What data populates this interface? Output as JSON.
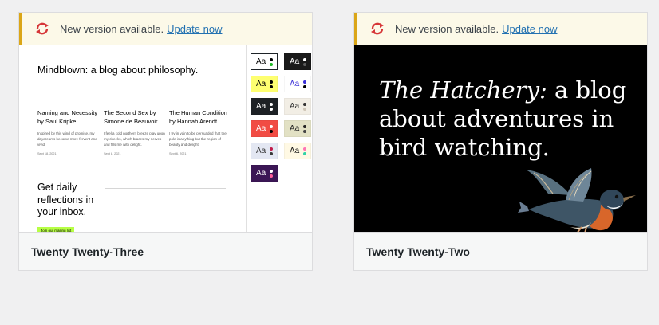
{
  "notice": {
    "text": "New version available.",
    "link": "Update now"
  },
  "themes": [
    {
      "name": "Twenty Twenty-Three",
      "preview": {
        "site_title": "Mindblown: a blog about philosophy.",
        "posts": [
          {
            "title": "Naming and Necessity by Saul Kripke",
            "excerpt": "Inspired by this wind of promise, my daydreams become more fervent and vivid.",
            "date": "Sept 18, 2021"
          },
          {
            "title": "The Second Sex by Simone de Beauvoir",
            "excerpt": "I feel a cold northern breeze play upon my cheeks, which braces my nerves and fills me with delight.",
            "date": "Sept 8, 2021"
          },
          {
            "title": "The Human Condition by Hannah Arendt",
            "excerpt": "I try in vain to be persuaded that the pole is anything but the region of beauty and delight.",
            "date": "Sept 6, 2021"
          }
        ],
        "cta": "Get daily reflections in your inbox.",
        "cta_button": "Join our mailing list",
        "swatch_label": "Aa",
        "swatches": [
          {
            "bg": "#ffffff",
            "fg": "#000000",
            "dots": [
              "#000000",
              "#1db924"
            ],
            "selected": true
          },
          {
            "bg": "#1a1a1a",
            "fg": "#ffffff",
            "dots": [
              "#ffffff",
              "#5b5b5b"
            ]
          },
          {
            "bg": "#feff70",
            "fg": "#000000",
            "dots": [
              "#000000",
              "#000000"
            ]
          },
          {
            "bg": "#ffffff",
            "fg": "#3a2fd8",
            "dots": [
              "#3a2fd8",
              "#000000"
            ]
          },
          {
            "bg": "#1d2125",
            "fg": "#ffffff",
            "dots": [
              "#ffffff",
              "#ffffff"
            ]
          },
          {
            "bg": "#f2eee5",
            "fg": "#333333",
            "dots": [
              "#333333",
              "#cfc6b8"
            ]
          },
          {
            "bg": "#f14c44",
            "fg": "#ffffff",
            "dots": [
              "#ffffff",
              "#000000"
            ]
          },
          {
            "bg": "#e2e1c4",
            "fg": "#222222",
            "dots": [
              "#222222",
              "#444444"
            ]
          },
          {
            "bg": "#e3e7f2",
            "fg": "#333333",
            "dots": [
              "#c11c4a",
              "#3a3a3a"
            ]
          },
          {
            "bg": "#fff9e4",
            "fg": "#111111",
            "dots": [
              "#ff74b4",
              "#31d3a6"
            ]
          },
          {
            "bg": "#3b1655",
            "fg": "#ffffff",
            "dots": [
              "#ffffff",
              "#ff5d9a"
            ]
          }
        ]
      }
    },
    {
      "name": "Twenty Twenty-Two",
      "preview": {
        "headline_em": "The Hatchery:",
        "headline_rest": " a blog about adventures in bird watching."
      }
    }
  ],
  "colors": {
    "notice_accent": "#dba617",
    "link": "#2271b1",
    "update_icon": "#d63638"
  }
}
